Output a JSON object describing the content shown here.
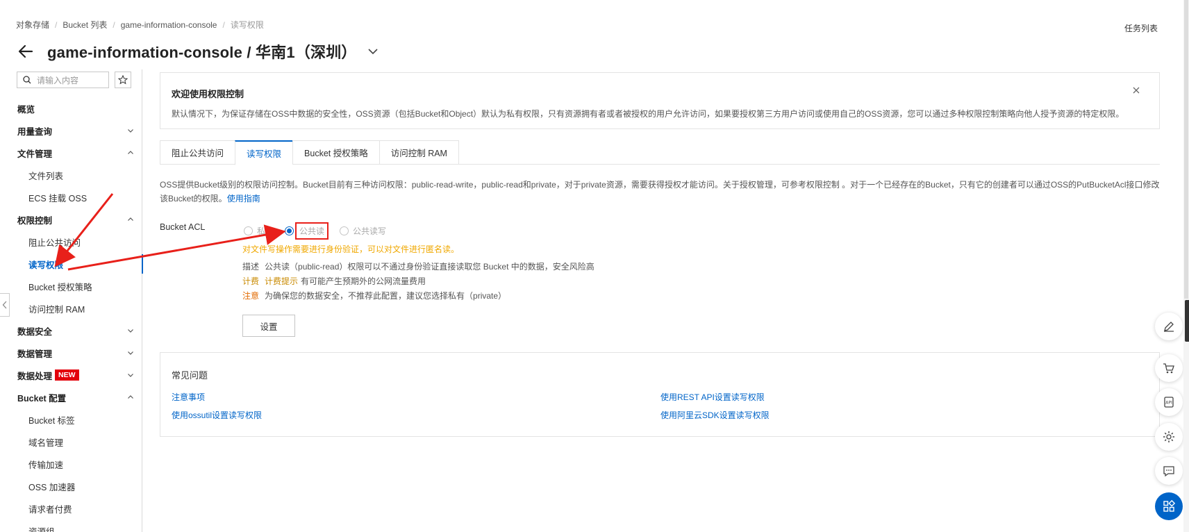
{
  "breadcrumb": {
    "items": [
      "对象存储",
      "Bucket 列表",
      "game-information-console"
    ],
    "current": "读写权限"
  },
  "header": {
    "title": "game-information-console / 华南1（深圳）",
    "task_list": "任务列表"
  },
  "sidebar": {
    "search_placeholder": "请输入内容",
    "items": [
      {
        "label": "概览"
      },
      {
        "label": "用量查询"
      },
      {
        "label": "文件管理"
      },
      {
        "label": "文件列表"
      },
      {
        "label": "ECS 挂载 OSS"
      },
      {
        "label": "权限控制"
      },
      {
        "label": "阻止公共访问"
      },
      {
        "label": "读写权限"
      },
      {
        "label": "Bucket 授权策略"
      },
      {
        "label": "访问控制 RAM"
      },
      {
        "label": "数据安全"
      },
      {
        "label": "数据管理"
      },
      {
        "label": "数据处理",
        "badge": "NEW"
      },
      {
        "label": "Bucket 配置"
      },
      {
        "label": "Bucket 标签"
      },
      {
        "label": "域名管理"
      },
      {
        "label": "传输加速"
      },
      {
        "label": "OSS 加速器"
      },
      {
        "label": "请求者付费"
      },
      {
        "label": "资源组"
      }
    ]
  },
  "notice": {
    "title": "欢迎使用权限控制",
    "text": "默认情况下，为保证存储在OSS中数据的安全性，OSS资源（包括Bucket和Object）默认为私有权限，只有资源拥有者或者被授权的用户允许访问，如果要授权第三方用户访问或使用自己的OSS资源，您可以通过多种权限控制策略向他人授予资源的特定权限。"
  },
  "tabs": [
    {
      "label": "阻止公共访问"
    },
    {
      "label": "读写权限"
    },
    {
      "label": "Bucket 授权策略"
    },
    {
      "label": "访问控制 RAM"
    }
  ],
  "description": {
    "line1": "OSS提供Bucket级别的权限访问控制。Bucket目前有三种访问权限：public-read-write，public-read和private，对于private资源，需要获得授权才能访问。关于授权管理，可参考权限控制 。对于一个已经存在的Bucket，只有它的创建者可以通过OSS的PutBucketAcl接口修改",
    "line2": "该Bucket的权限。",
    "link": "使用指南"
  },
  "acl": {
    "label": "Bucket ACL",
    "options": [
      "私有",
      "公共读",
      "公共读写"
    ],
    "selected": "公共读",
    "warning": "对文件写操作需要进行身份验证，可以对文件进行匿名读。",
    "desc_key": "描述",
    "desc_text": "公共读（public-read）权限可以不通过身份验证直接读取您 Bucket 中的数据，安全风险高",
    "bill_key": "计费",
    "bill_hint": "计费提示",
    "bill_text": "有可能产生预期外的公网流量费用",
    "note_key": "注意",
    "note_text": "为确保您的数据安全，不推荐此配置，建议您选择私有（private）",
    "button": "设置"
  },
  "faq": {
    "title": "常见问题",
    "links": [
      "注意事项",
      "使用REST API设置读写权限",
      "使用ossutil设置读写权限",
      "使用阿里云SDK设置读写权限"
    ]
  },
  "colors": {
    "primary": "#0064c8",
    "warning": "#f0a800",
    "annotation": "#e8201a"
  }
}
